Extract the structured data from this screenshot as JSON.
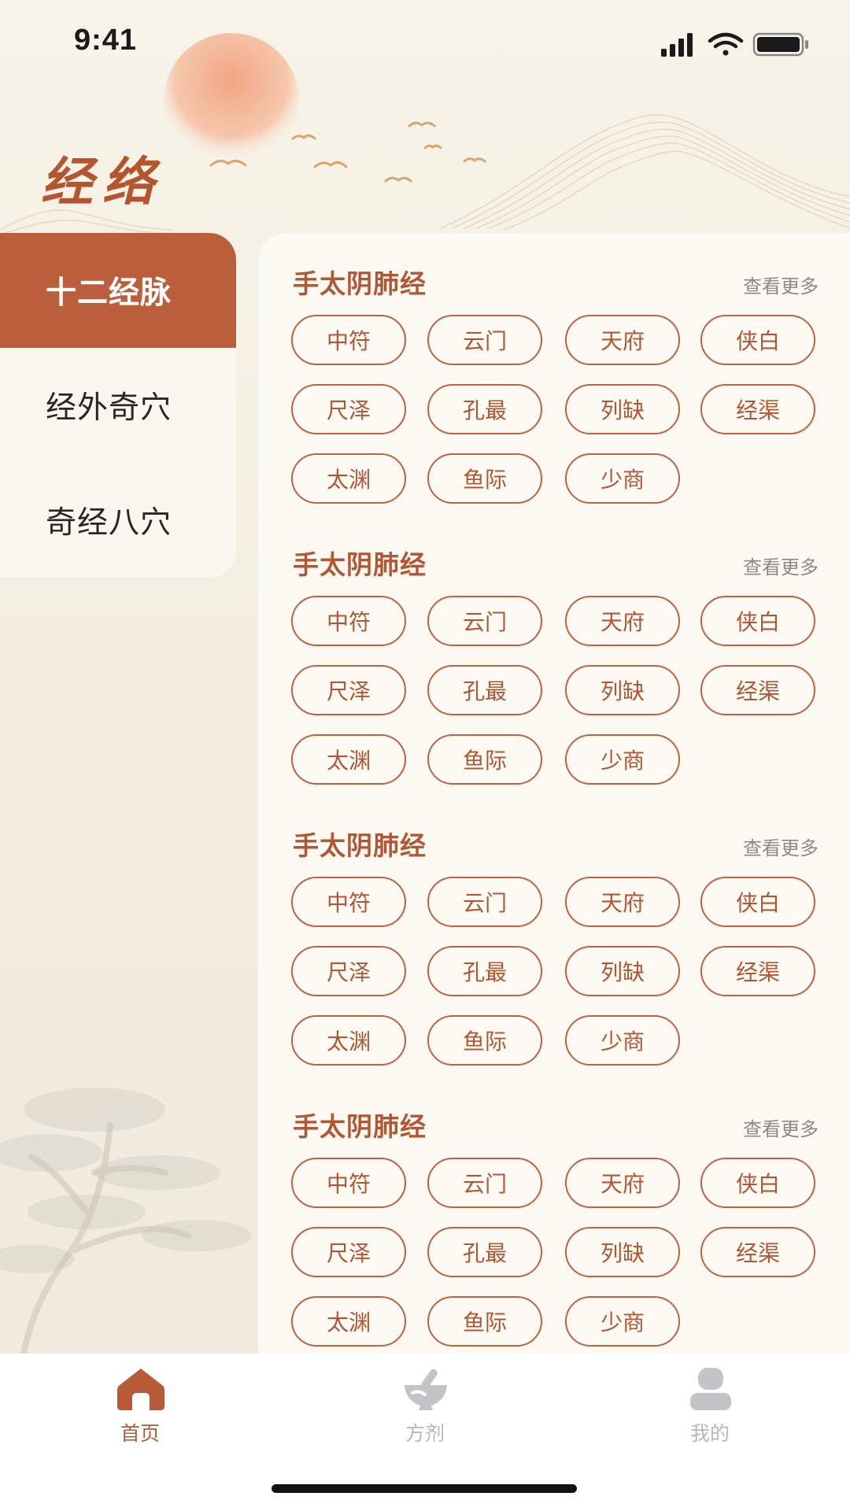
{
  "status_bar": {
    "time": "9:41"
  },
  "header": {
    "title": "经络"
  },
  "side_menu": {
    "items": [
      {
        "label": "十二经脉",
        "active": true
      },
      {
        "label": "经外奇穴",
        "active": false
      },
      {
        "label": "奇经八穴",
        "active": false
      }
    ]
  },
  "sections": [
    {
      "title": "手太阴肺经",
      "more": "查看更多",
      "points": [
        "中符",
        "云门",
        "天府",
        "侠白",
        "尺泽",
        "孔最",
        "列缺",
        "经渠",
        "太渊",
        "鱼际",
        "少商"
      ]
    },
    {
      "title": "手太阴肺经",
      "more": "查看更多",
      "points": [
        "中符",
        "云门",
        "天府",
        "侠白",
        "尺泽",
        "孔最",
        "列缺",
        "经渠",
        "太渊",
        "鱼际",
        "少商"
      ]
    },
    {
      "title": "手太阴肺经",
      "more": "查看更多",
      "points": [
        "中符",
        "云门",
        "天府",
        "侠白",
        "尺泽",
        "孔最",
        "列缺",
        "经渠",
        "太渊",
        "鱼际",
        "少商"
      ]
    },
    {
      "title": "手太阴肺经",
      "more": "查看更多",
      "points": [
        "中符",
        "云门",
        "天府",
        "侠白",
        "尺泽",
        "孔最",
        "列缺",
        "经渠",
        "太渊",
        "鱼际",
        "少商"
      ]
    }
  ],
  "tab_bar": {
    "tabs": [
      {
        "label": "首页",
        "icon": "home-icon",
        "active": true
      },
      {
        "label": "方剂",
        "icon": "mortar-pestle-icon",
        "active": false
      },
      {
        "label": "我的",
        "icon": "user-icon",
        "active": false
      }
    ]
  },
  "colors": {
    "accent": "#bb5e3c",
    "accent_text": "#b25634",
    "inactive_tab": "#b8b8b8",
    "background": "#f7f3e8",
    "panel": "#fcf9f2"
  }
}
